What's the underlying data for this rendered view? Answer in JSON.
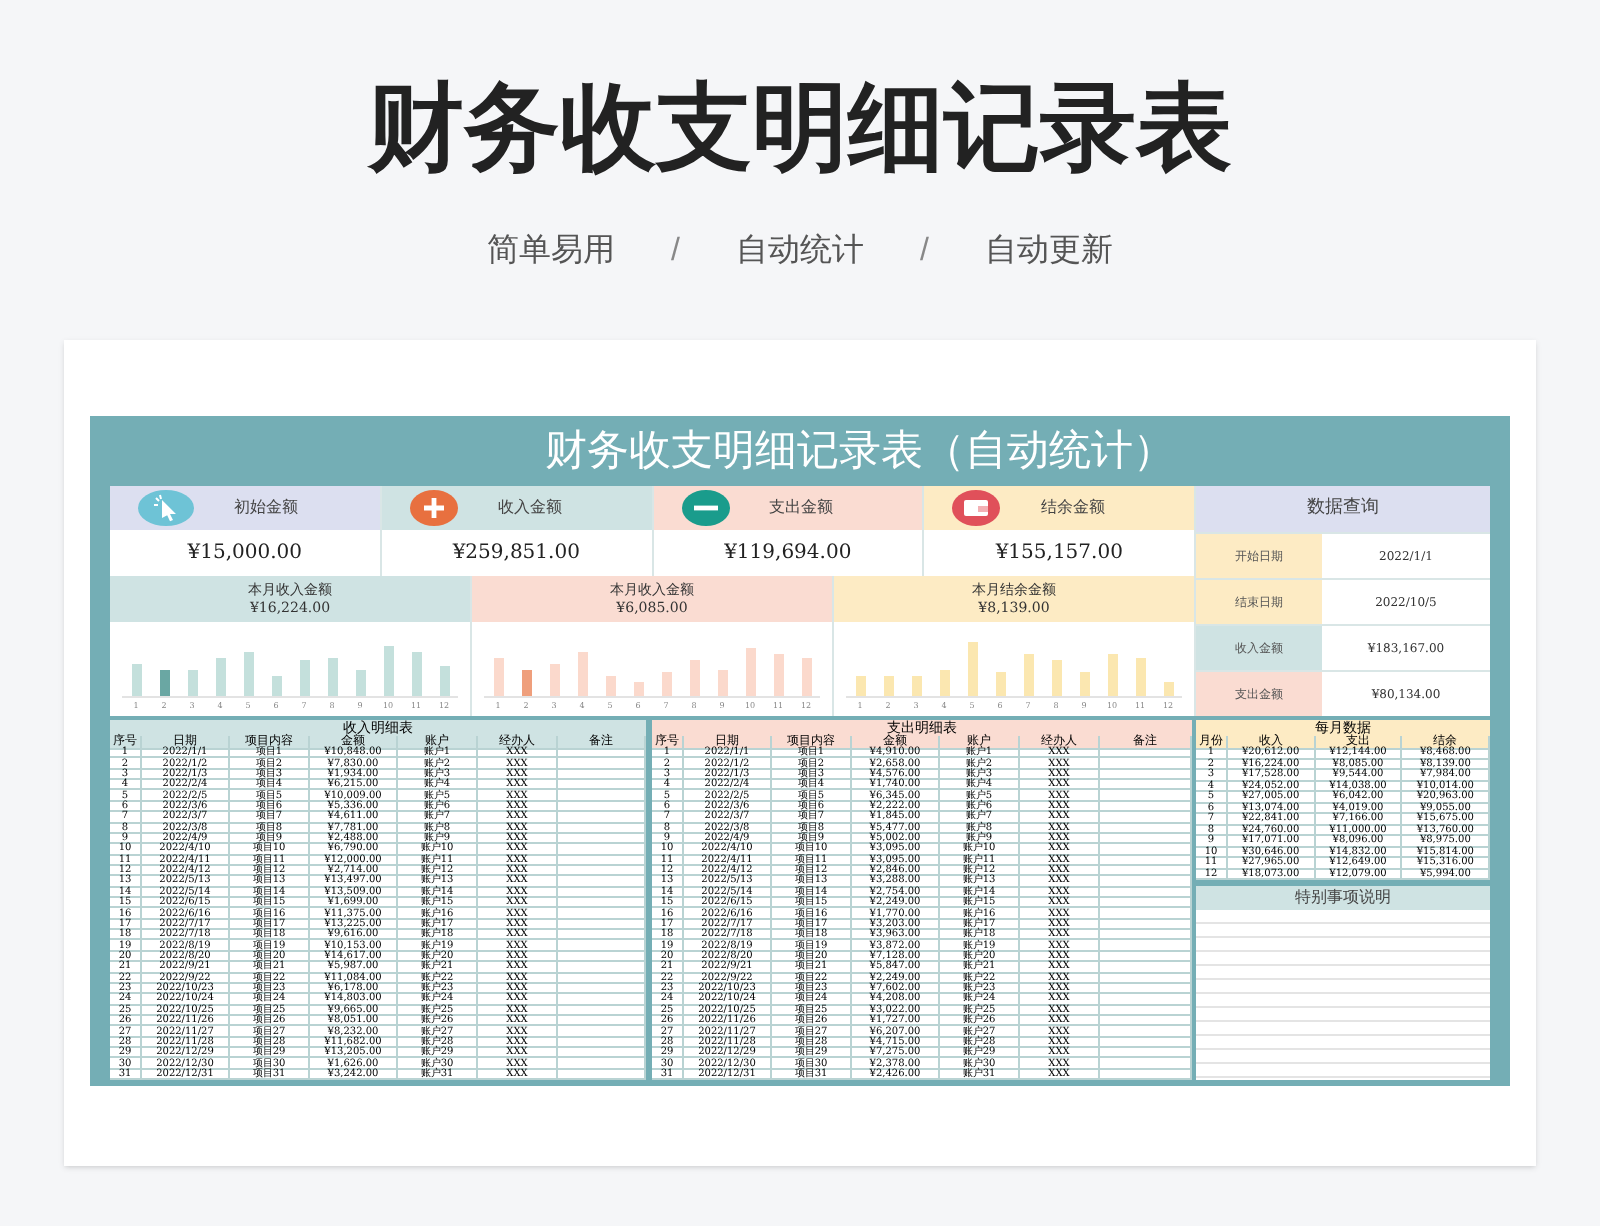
{
  "page_title": "财务收支明细记录表",
  "taglines": [
    {
      "text": "简单易用",
      "kind": "word"
    },
    {
      "text": "/",
      "kind": "slash"
    },
    {
      "text": "自动统计",
      "kind": "word"
    },
    {
      "text": "/",
      "kind": "slash"
    },
    {
      "text": "自动更新",
      "kind": "word"
    }
  ],
  "sheet_title": "财务收支明细记录表（自动统计）",
  "summary": [
    {
      "label": "初始金额",
      "value": "¥15,000.00",
      "color": "#dcdff0",
      "kind": "cursor"
    },
    {
      "label": "收入金额",
      "value": "¥259,851.00",
      "color": "#cfe3e3",
      "kind": "plus"
    },
    {
      "label": "支出金额",
      "value": "¥119,694.00",
      "color": "#fadcd2",
      "kind": "minus"
    },
    {
      "label": "结余金额",
      "value": "¥155,157.00",
      "color": "#fdebc4",
      "kind": "wallet"
    }
  ],
  "month_cards": [
    {
      "label": "本月收入金额",
      "value": "¥16,224.00",
      "color": "#cfe3e3",
      "kind": "teal",
      "bars": [
        {
          "label": "1",
          "selected": false
        },
        {
          "label": "2",
          "selected": true
        },
        {
          "label": "3",
          "selected": false
        },
        {
          "label": "4",
          "selected": false
        },
        {
          "label": "5",
          "selected": false
        },
        {
          "label": "6",
          "selected": false
        },
        {
          "label": "7",
          "selected": false
        },
        {
          "label": "8",
          "selected": false
        },
        {
          "label": "9",
          "selected": false
        },
        {
          "label": "10",
          "selected": false
        },
        {
          "label": "11",
          "selected": false
        },
        {
          "label": "12",
          "selected": false
        }
      ]
    },
    {
      "label": "本月收入金额",
      "value": "¥6,085.00",
      "color": "#fadcd2",
      "kind": "salmon",
      "bars": [
        {
          "label": "1",
          "selected": false
        },
        {
          "label": "2",
          "selected": true
        },
        {
          "label": "3",
          "selected": false
        },
        {
          "label": "4",
          "selected": false
        },
        {
          "label": "5",
          "selected": false
        },
        {
          "label": "6",
          "selected": false
        },
        {
          "label": "7",
          "selected": false
        },
        {
          "label": "8",
          "selected": false
        },
        {
          "label": "9",
          "selected": false
        },
        {
          "label": "10",
          "selected": false
        },
        {
          "label": "11",
          "selected": false
        },
        {
          "label": "12",
          "selected": false
        }
      ]
    },
    {
      "label": "本月结余金额",
      "value": "¥8,139.00",
      "color": "#fdebc4",
      "kind": "yellow",
      "bars": [
        {
          "label": "1",
          "selected": false
        },
        {
          "label": "2",
          "selected": false
        },
        {
          "label": "3",
          "selected": false
        },
        {
          "label": "4",
          "selected": false
        },
        {
          "label": "5",
          "selected": false
        },
        {
          "label": "6",
          "selected": false
        },
        {
          "label": "7",
          "selected": false
        },
        {
          "label": "8",
          "selected": false
        },
        {
          "label": "9",
          "selected": false
        },
        {
          "label": "10",
          "selected": false
        },
        {
          "label": "11",
          "selected": false
        },
        {
          "label": "12",
          "selected": false
        }
      ]
    }
  ],
  "query": {
    "title": "数据查询",
    "rows": [
      {
        "label": "开始日期",
        "value": "2022/1/1",
        "color": "#fdebc4"
      },
      {
        "label": "结束日期",
        "value": "2022/10/5",
        "color": "#fdebc4"
      },
      {
        "label": "收入金额",
        "value": "¥183,167.00",
        "color": "#cfe3e3"
      },
      {
        "label": "支出金额",
        "value": "¥80,134.00",
        "color": "#fadcd2"
      }
    ]
  },
  "income_table": {
    "title": "收入明细表",
    "columns": [
      "序号",
      "日期",
      "项目内容",
      "金额",
      "账户",
      "经办人",
      "备注"
    ],
    "rows": [
      [
        "1",
        "2022/1/1",
        "项目1",
        "¥10,848.00",
        "账户1",
        "XXX"
      ],
      [
        "2",
        "2022/1/2",
        "项目2",
        "¥7,830.00",
        "账户2",
        "XXX"
      ],
      [
        "3",
        "2022/1/3",
        "项目3",
        "¥1,934.00",
        "账户3",
        "XXX"
      ],
      [
        "4",
        "2022/2/4",
        "项目4",
        "¥6,215.00",
        "账户4",
        "XXX"
      ],
      [
        "5",
        "2022/2/5",
        "项目5",
        "¥10,009.00",
        "账户5",
        "XXX"
      ],
      [
        "6",
        "2022/3/6",
        "项目6",
        "¥5,336.00",
        "账户6",
        "XXX"
      ],
      [
        "7",
        "2022/3/7",
        "项目7",
        "¥4,611.00",
        "账户7",
        "XXX"
      ],
      [
        "8",
        "2022/3/8",
        "项目8",
        "¥7,781.00",
        "账户8",
        "XXX"
      ],
      [
        "9",
        "2022/4/9",
        "项目9",
        "¥2,488.00",
        "账户9",
        "XXX"
      ],
      [
        "10",
        "2022/4/10",
        "项目10",
        "¥6,790.00",
        "账户10",
        "XXX"
      ],
      [
        "11",
        "2022/4/11",
        "项目11",
        "¥12,000.00",
        "账户11",
        "XXX"
      ],
      [
        "12",
        "2022/4/12",
        "项目12",
        "¥2,714.00",
        "账户12",
        "XXX"
      ],
      [
        "13",
        "2022/5/13",
        "项目13",
        "¥13,497.00",
        "账户13",
        "XXX"
      ],
      [
        "14",
        "2022/5/14",
        "项目14",
        "¥13,509.00",
        "账户14",
        "XXX"
      ],
      [
        "15",
        "2022/6/15",
        "项目15",
        "¥1,699.00",
        "账户15",
        "XXX"
      ],
      [
        "16",
        "2022/6/16",
        "项目16",
        "¥11,375.00",
        "账户16",
        "XXX"
      ],
      [
        "17",
        "2022/7/17",
        "项目17",
        "¥13,225.00",
        "账户17",
        "XXX"
      ],
      [
        "18",
        "2022/7/18",
        "项目18",
        "¥9,616.00",
        "账户18",
        "XXX"
      ],
      [
        "19",
        "2022/8/19",
        "项目19",
        "¥10,153.00",
        "账户19",
        "XXX"
      ],
      [
        "20",
        "2022/8/20",
        "项目20",
        "¥14,617.00",
        "账户20",
        "XXX"
      ],
      [
        "21",
        "2022/9/21",
        "项目21",
        "¥5,987.00",
        "账户21",
        "XXX"
      ],
      [
        "22",
        "2022/9/22",
        "项目22",
        "¥11,084.00",
        "账户22",
        "XXX"
      ],
      [
        "23",
        "2022/10/23",
        "项目23",
        "¥6,178.00",
        "账户23",
        "XXX"
      ],
      [
        "24",
        "2022/10/24",
        "项目24",
        "¥14,803.00",
        "账户24",
        "XXX"
      ],
      [
        "25",
        "2022/10/25",
        "项目25",
        "¥9,665.00",
        "账户25",
        "XXX"
      ],
      [
        "26",
        "2022/11/26",
        "项目26",
        "¥8,051.00",
        "账户26",
        "XXX"
      ],
      [
        "27",
        "2022/11/27",
        "项目27",
        "¥8,232.00",
        "账户27",
        "XXX"
      ],
      [
        "28",
        "2022/11/28",
        "项目28",
        "¥11,682.00",
        "账户28",
        "XXX"
      ],
      [
        "29",
        "2022/12/29",
        "项目29",
        "¥13,205.00",
        "账户29",
        "XXX"
      ],
      [
        "30",
        "2022/12/30",
        "项目30",
        "¥1,626.00",
        "账户30",
        "XXX"
      ],
      [
        "31",
        "2022/12/31",
        "项目31",
        "¥3,242.00",
        "账户31",
        "XXX"
      ]
    ]
  },
  "expense_table": {
    "title": "支出明细表",
    "columns": [
      "序号",
      "日期",
      "项目内容",
      "金额",
      "账户",
      "经办人",
      "备注"
    ],
    "rows": [
      [
        "1",
        "2022/1/1",
        "项目1",
        "¥4,910.00",
        "账户1",
        "XXX"
      ],
      [
        "2",
        "2022/1/2",
        "项目2",
        "¥2,658.00",
        "账户2",
        "XXX"
      ],
      [
        "3",
        "2022/1/3",
        "项目3",
        "¥4,576.00",
        "账户3",
        "XXX"
      ],
      [
        "4",
        "2022/2/4",
        "项目4",
        "¥1,740.00",
        "账户4",
        "XXX"
      ],
      [
        "5",
        "2022/2/5",
        "项目5",
        "¥6,345.00",
        "账户5",
        "XXX"
      ],
      [
        "6",
        "2022/3/6",
        "项目6",
        "¥2,222.00",
        "账户6",
        "XXX"
      ],
      [
        "7",
        "2022/3/7",
        "项目7",
        "¥1,845.00",
        "账户7",
        "XXX"
      ],
      [
        "8",
        "2022/3/8",
        "项目8",
        "¥5,477.00",
        "账户8",
        "XXX"
      ],
      [
        "9",
        "2022/4/9",
        "项目9",
        "¥5,002.00",
        "账户9",
        "XXX"
      ],
      [
        "10",
        "2022/4/10",
        "项目10",
        "¥3,095.00",
        "账户10",
        "XXX"
      ],
      [
        "11",
        "2022/4/11",
        "项目11",
        "¥3,095.00",
        "账户11",
        "XXX"
      ],
      [
        "12",
        "2022/4/12",
        "项目12",
        "¥2,846.00",
        "账户12",
        "XXX"
      ],
      [
        "13",
        "2022/5/13",
        "项目13",
        "¥3,288.00",
        "账户13",
        "XXX"
      ],
      [
        "14",
        "2022/5/14",
        "项目14",
        "¥2,754.00",
        "账户14",
        "XXX"
      ],
      [
        "15",
        "2022/6/15",
        "项目15",
        "¥2,249.00",
        "账户15",
        "XXX"
      ],
      [
        "16",
        "2022/6/16",
        "项目16",
        "¥1,770.00",
        "账户16",
        "XXX"
      ],
      [
        "17",
        "2022/7/17",
        "项目17",
        "¥3,203.00",
        "账户17",
        "XXX"
      ],
      [
        "18",
        "2022/7/18",
        "项目18",
        "¥3,963.00",
        "账户18",
        "XXX"
      ],
      [
        "19",
        "2022/8/19",
        "项目19",
        "¥3,872.00",
        "账户19",
        "XXX"
      ],
      [
        "20",
        "2022/8/20",
        "项目20",
        "¥7,128.00",
        "账户20",
        "XXX"
      ],
      [
        "21",
        "2022/9/21",
        "项目21",
        "¥5,847.00",
        "账户21",
        "XXX"
      ],
      [
        "22",
        "2022/9/22",
        "项目22",
        "¥2,249.00",
        "账户22",
        "XXX"
      ],
      [
        "23",
        "2022/10/23",
        "项目23",
        "¥7,602.00",
        "账户23",
        "XXX"
      ],
      [
        "24",
        "2022/10/24",
        "项目24",
        "¥4,208.00",
        "账户24",
        "XXX"
      ],
      [
        "25",
        "2022/10/25",
        "项目25",
        "¥3,022.00",
        "账户25",
        "XXX"
      ],
      [
        "26",
        "2022/11/26",
        "项目26",
        "¥1,727.00",
        "账户26",
        "XXX"
      ],
      [
        "27",
        "2022/11/27",
        "项目27",
        "¥6,207.00",
        "账户27",
        "XXX"
      ],
      [
        "28",
        "2022/11/28",
        "项目28",
        "¥4,715.00",
        "账户28",
        "XXX"
      ],
      [
        "29",
        "2022/12/29",
        "项目29",
        "¥7,275.00",
        "账户29",
        "XXX"
      ],
      [
        "30",
        "2022/12/30",
        "项目30",
        "¥2,378.00",
        "账户30",
        "XXX"
      ],
      [
        "31",
        "2022/12/31",
        "项目31",
        "¥2,426.00",
        "账户31",
        "XXX"
      ]
    ]
  },
  "monthly_table": {
    "title": "每月数据",
    "columns": [
      "月份",
      "收入",
      "支出",
      "结余"
    ],
    "rows": [
      [
        "1",
        "¥20,612.00",
        "¥12,144.00",
        "¥8,468.00"
      ],
      [
        "2",
        "¥16,224.00",
        "¥8,085.00",
        "¥8,139.00"
      ],
      [
        "3",
        "¥17,528.00",
        "¥9,544.00",
        "¥7,984.00"
      ],
      [
        "4",
        "¥24,052.00",
        "¥14,038.00",
        "¥10,014.00"
      ],
      [
        "5",
        "¥27,005.00",
        "¥6,042.00",
        "¥20,963.00"
      ],
      [
        "6",
        "¥13,074.00",
        "¥4,019.00",
        "¥9,055.00"
      ],
      [
        "7",
        "¥22,841.00",
        "¥7,166.00",
        "¥15,675.00"
      ],
      [
        "8",
        "¥24,760.00",
        "¥11,000.00",
        "¥13,760.00"
      ],
      [
        "9",
        "¥17,071.00",
        "¥8,096.00",
        "¥8,975.00"
      ],
      [
        "10",
        "¥30,646.00",
        "¥14,832.00",
        "¥15,814.00"
      ],
      [
        "11",
        "¥27,965.00",
        "¥12,649.00",
        "¥15,316.00"
      ],
      [
        "12",
        "¥18,073.00",
        "¥12,079.00",
        "¥5,994.00"
      ]
    ]
  },
  "notes": {
    "title": "特别事项说明"
  }
}
